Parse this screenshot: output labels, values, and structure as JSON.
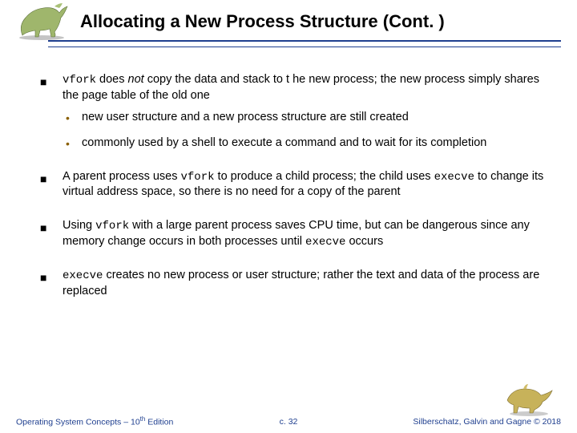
{
  "title": "Allocating a New Process Structure (Cont. )",
  "bullets": {
    "b1_pre": "vfork",
    "b1_mid_a": " does ",
    "b1_mid_it": "not",
    "b1_post": " copy the data and stack to t he new process; the new process simply shares the page table of the old one",
    "b1_sub1": "new user structure and a new process structure are still created",
    "b1_sub2": "commonly used by a shell to execute a command and to wait for its completion",
    "b2_a": "A parent process uses ",
    "b2_code1": "vfork",
    "b2_b": " to produce a child process; the child uses ",
    "b2_code2": "execve",
    "b2_c": " to change its virtual address space, so there is no need for a copy of the parent",
    "b3_a": "Using ",
    "b3_code1": "vfork",
    "b3_b": " with a large parent process saves CPU time, but can be dangerous since any memory change occurs in both processes until ",
    "b3_code2": "execve",
    "b3_c": " occurs",
    "b4_code": "execve",
    "b4_text": " creates no new process or user structure; rather the text and data of the process are replaced"
  },
  "footer": {
    "left_a": "Operating System Concepts – 10",
    "left_sup": "th",
    "left_b": " Edition",
    "center": "c. 32",
    "right": "Silberschatz, Galvin and Gagne © 2018"
  }
}
